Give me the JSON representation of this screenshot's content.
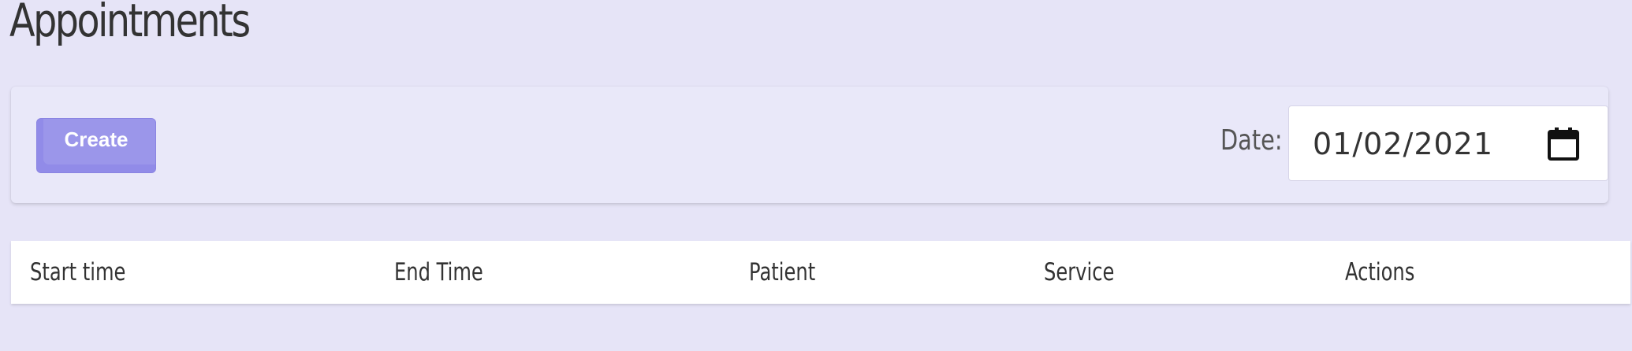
{
  "page": {
    "title": "Appointments"
  },
  "toolbar": {
    "create_label": "Create",
    "date_label": "Date:",
    "date_value": "01/02/2021"
  },
  "icons": {
    "calendar": "calendar-icon"
  },
  "table": {
    "columns": [
      "Start time",
      "End Time",
      "Patient",
      "Service",
      "Actions"
    ]
  },
  "colors": {
    "background": "#e6e4f7",
    "accent": "#9b96ea"
  }
}
